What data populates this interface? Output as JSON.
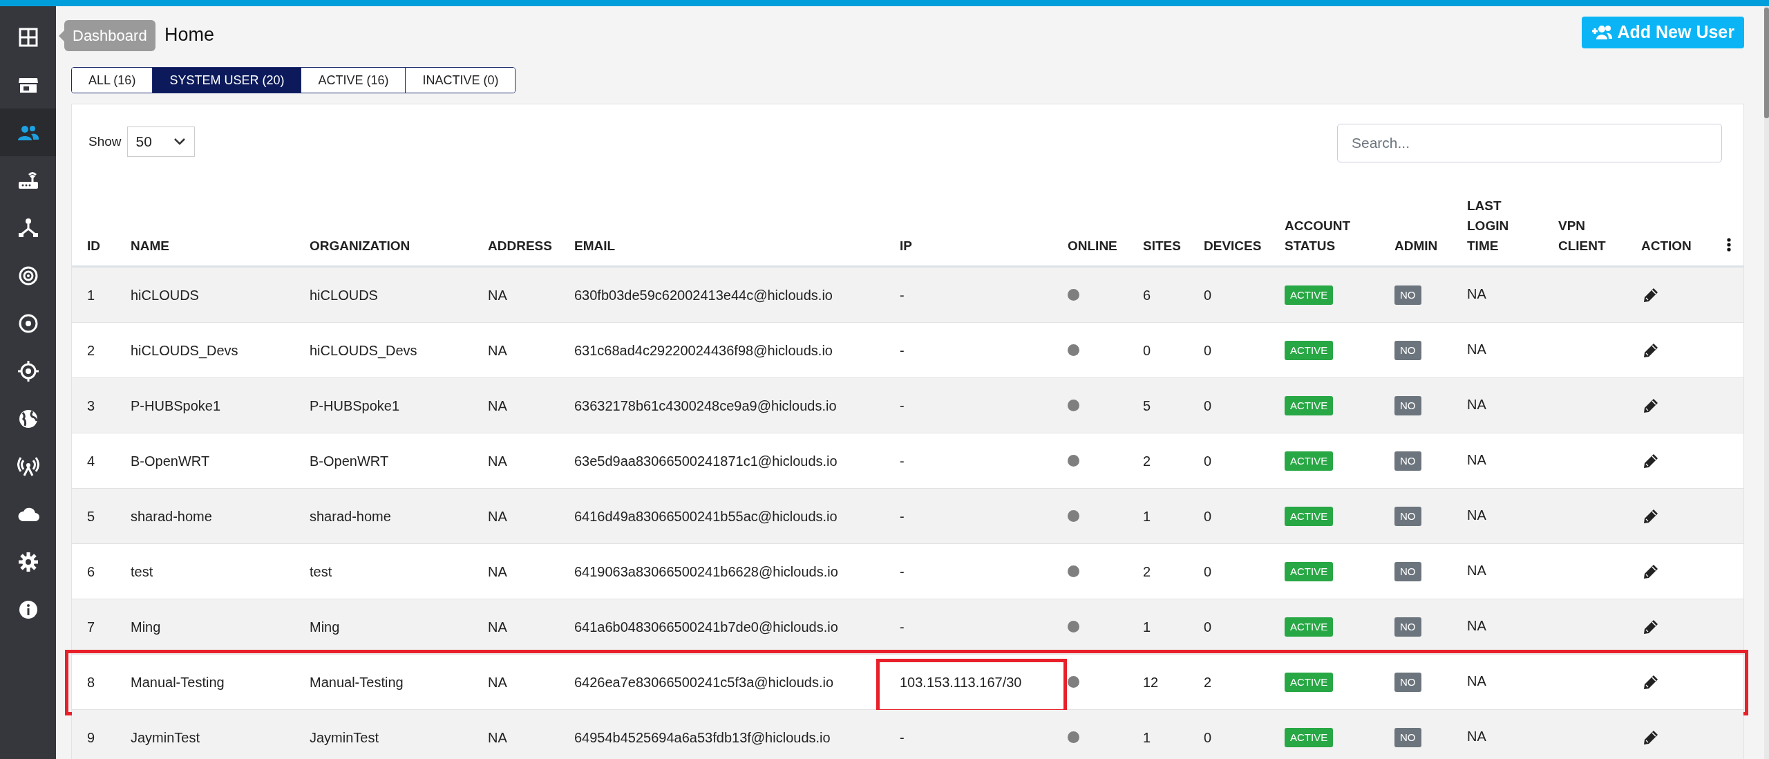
{
  "page": {
    "title": "Home"
  },
  "sidebar": {
    "tooltip": "Dashboard",
    "items": [
      {
        "selected": false
      },
      {
        "selected": false
      },
      {
        "selected": true
      },
      {
        "selected": false
      },
      {
        "selected": false
      },
      {
        "selected": false
      },
      {
        "selected": false
      },
      {
        "selected": false
      },
      {
        "selected": false
      },
      {
        "selected": false
      },
      {
        "selected": false
      },
      {
        "selected": false
      },
      {
        "selected": false
      }
    ]
  },
  "add_button": "Add New User",
  "tabs": [
    {
      "label": "ALL (16)",
      "selected": false
    },
    {
      "label": "SYSTEM USER (20)",
      "selected": true
    },
    {
      "label": "ACTIVE (16)",
      "selected": false
    },
    {
      "label": "INACTIVE (0)",
      "selected": false
    }
  ],
  "table": {
    "show_label": "Show",
    "page_size": "50",
    "search": {
      "placeholder": "Search..."
    },
    "columns": [
      "ID",
      "NAME",
      "ORGANIZATION",
      "ADDRESS",
      "EMAIL",
      "IP",
      "ONLINE",
      "SITES",
      "DEVICES",
      "ACCOUNT STATUS",
      "ADMIN",
      "LAST LOGIN TIME",
      "VPN CLIENT",
      "ACTION"
    ],
    "rows": [
      {
        "id": "1",
        "name": "hiCLOUDS",
        "organization": "hiCLOUDS",
        "address": "NA",
        "email": "630fb03de59c62002413e44c@hiclouds.io",
        "ip": "-",
        "online": false,
        "sites": "6",
        "devices": "0",
        "account_status": "ACTIVE",
        "admin": "NO",
        "last_login": "NA",
        "highlighted": false,
        "ip_boxed": false
      },
      {
        "id": "2",
        "name": "hiCLOUDS_Devs",
        "organization": "hiCLOUDS_Devs",
        "address": "NA",
        "email": "631c68ad4c29220024436f98@hiclouds.io",
        "ip": "-",
        "online": false,
        "sites": "0",
        "devices": "0",
        "account_status": "ACTIVE",
        "admin": "NO",
        "last_login": "NA",
        "highlighted": false,
        "ip_boxed": false
      },
      {
        "id": "3",
        "name": "P-HUBSpoke1",
        "organization": "P-HUBSpoke1",
        "address": "NA",
        "email": "63632178b61c4300248ce9a9@hiclouds.io",
        "ip": "-",
        "online": false,
        "sites": "5",
        "devices": "0",
        "account_status": "ACTIVE",
        "admin": "NO",
        "last_login": "NA",
        "highlighted": false,
        "ip_boxed": false
      },
      {
        "id": "4",
        "name": "B-OpenWRT",
        "organization": "B-OpenWRT",
        "address": "NA",
        "email": "63e5d9aa83066500241871c1@hiclouds.io",
        "ip": "-",
        "online": false,
        "sites": "2",
        "devices": "0",
        "account_status": "ACTIVE",
        "admin": "NO",
        "last_login": "NA",
        "highlighted": false,
        "ip_boxed": false
      },
      {
        "id": "5",
        "name": "sharad-home",
        "organization": "sharad-home",
        "address": "NA",
        "email": "6416d49a83066500241b55ac@hiclouds.io",
        "ip": "-",
        "online": false,
        "sites": "1",
        "devices": "0",
        "account_status": "ACTIVE",
        "admin": "NO",
        "last_login": "NA",
        "highlighted": false,
        "ip_boxed": false
      },
      {
        "id": "6",
        "name": "test",
        "organization": "test",
        "address": "NA",
        "email": "6419063a83066500241b6628@hiclouds.io",
        "ip": "-",
        "online": false,
        "sites": "2",
        "devices": "0",
        "account_status": "ACTIVE",
        "admin": "NO",
        "last_login": "NA",
        "highlighted": false,
        "ip_boxed": false
      },
      {
        "id": "7",
        "name": "Ming",
        "organization": "Ming",
        "address": "NA",
        "email": "641a6b0483066500241b7de0@hiclouds.io",
        "ip": "-",
        "online": false,
        "sites": "1",
        "devices": "0",
        "account_status": "ACTIVE",
        "admin": "NO",
        "last_login": "NA",
        "highlighted": false,
        "ip_boxed": false
      },
      {
        "id": "8",
        "name": "Manual-Testing",
        "organization": "Manual-Testing",
        "address": "NA",
        "email": "6426ea7e83066500241c5f3a@hiclouds.io",
        "ip": "103.153.113.167/30",
        "online": false,
        "sites": "12",
        "devices": "2",
        "account_status": "ACTIVE",
        "admin": "NO",
        "last_login": "NA",
        "highlighted": true,
        "ip_boxed": true
      },
      {
        "id": "9",
        "name": "JayminTest",
        "organization": "JayminTest",
        "address": "NA",
        "email": "64954b4525694a6a53fdb13f@hiclouds.io",
        "ip": "-",
        "online": false,
        "sites": "1",
        "devices": "0",
        "account_status": "ACTIVE",
        "admin": "NO",
        "last_login": "NA",
        "highlighted": false,
        "ip_boxed": false
      }
    ]
  }
}
